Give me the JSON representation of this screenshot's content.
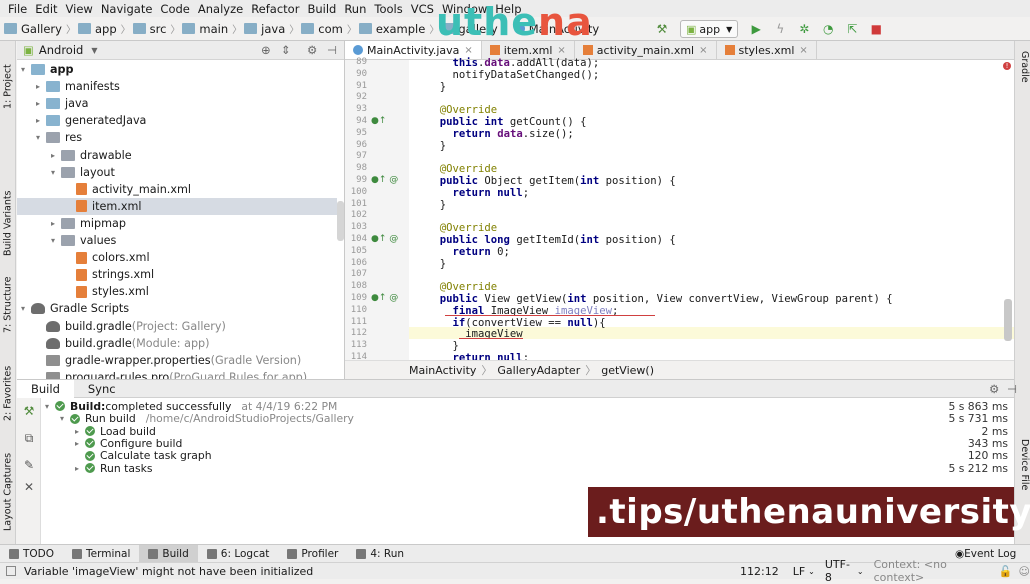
{
  "menu": [
    "File",
    "Edit",
    "View",
    "Navigate",
    "Code",
    "Analyze",
    "Refactor",
    "Build",
    "Run",
    "Tools",
    "VCS",
    "Window",
    "Help"
  ],
  "breadcrumb": [
    "Gallery",
    "app",
    "src",
    "main",
    "java",
    "com",
    "example",
    "gallery",
    "MainActivity"
  ],
  "logo": {
    "part1": "uthe",
    "part2": "na"
  },
  "run_config": "app",
  "project_view_label": "Android",
  "left_tool_tabs": [
    "1: Project",
    "Build Variants",
    "7: Structure",
    "2: Favorites",
    "Layout Captures"
  ],
  "right_tool_tabs": [
    "Gradle",
    "Device File"
  ],
  "tree": [
    {
      "label": "app",
      "extra": "",
      "icon": "folder",
      "indent": 0,
      "arrow": "▾"
    },
    {
      "label": "manifests",
      "extra": "",
      "icon": "folder",
      "indent": 1,
      "arrow": "▸"
    },
    {
      "label": "java",
      "extra": "",
      "icon": "folder",
      "indent": 1,
      "arrow": "▸"
    },
    {
      "label": "generatedJava",
      "extra": "",
      "icon": "folder",
      "indent": 1,
      "arrow": "▸"
    },
    {
      "label": "res",
      "extra": "",
      "icon": "folder-gray",
      "indent": 1,
      "arrow": "▾"
    },
    {
      "label": "drawable",
      "extra": "",
      "icon": "folder-gray",
      "indent": 2,
      "arrow": "▸"
    },
    {
      "label": "layout",
      "extra": "",
      "icon": "folder-gray",
      "indent": 2,
      "arrow": "▾"
    },
    {
      "label": "activity_main.xml",
      "extra": "",
      "icon": "xml",
      "indent": 3,
      "arrow": ""
    },
    {
      "label": "item.xml",
      "extra": "",
      "icon": "xml",
      "indent": 3,
      "arrow": "",
      "selected": true
    },
    {
      "label": "mipmap",
      "extra": "",
      "icon": "folder-gray",
      "indent": 2,
      "arrow": "▸"
    },
    {
      "label": "values",
      "extra": "",
      "icon": "folder-gray",
      "indent": 2,
      "arrow": "▾"
    },
    {
      "label": "colors.xml",
      "extra": "",
      "icon": "xml",
      "indent": 3,
      "arrow": ""
    },
    {
      "label": "strings.xml",
      "extra": "",
      "icon": "xml",
      "indent": 3,
      "arrow": ""
    },
    {
      "label": "styles.xml",
      "extra": "",
      "icon": "xml",
      "indent": 3,
      "arrow": ""
    },
    {
      "label": "Gradle Scripts",
      "extra": "",
      "icon": "gradle",
      "indent": 0,
      "arrow": "▾"
    },
    {
      "label": "build.gradle",
      "extra": " (Project: Gallery)",
      "icon": "gradle",
      "indent": 1,
      "arrow": ""
    },
    {
      "label": "build.gradle",
      "extra": " (Module: app)",
      "icon": "gradle",
      "indent": 1,
      "arrow": ""
    },
    {
      "label": "gradle-wrapper.properties",
      "extra": " (Gradle Version)",
      "icon": "prop",
      "indent": 1,
      "arrow": ""
    },
    {
      "label": "proguard-rules.pro",
      "extra": " (ProGuard Rules for app)",
      "icon": "prop",
      "indent": 1,
      "arrow": ""
    }
  ],
  "editor_tabs": [
    {
      "label": "MainActivity.java",
      "active": true
    },
    {
      "label": "item.xml",
      "active": false
    },
    {
      "label": "activity_main.xml",
      "active": false
    },
    {
      "label": "styles.xml",
      "active": false
    }
  ],
  "code_lines": [
    {
      "n": "89",
      "html": "    <span class=\"kw\">this</span>.<span class=\"fld\">data</span>.addAll(data);"
    },
    {
      "n": "90",
      "html": "    notifyDataSetChanged();"
    },
    {
      "n": "91",
      "html": "  }"
    },
    {
      "n": "92",
      "html": ""
    },
    {
      "n": "93",
      "html": "  <span class=\"an\">@Override</span>"
    },
    {
      "n": "94",
      "html": "  <span class=\"kw\">public int</span> getCount() {"
    },
    {
      "n": "95",
      "html": "    <span class=\"kw\">return</span> <span class=\"fld\">data</span>.size();"
    },
    {
      "n": "96",
      "html": "  }"
    },
    {
      "n": "97",
      "html": ""
    },
    {
      "n": "98",
      "html": "  <span class=\"an\">@Override</span>"
    },
    {
      "n": "99",
      "html": "  <span class=\"kw\">public</span> Object getItem(<span class=\"kw\">int</span> position) {"
    },
    {
      "n": "100",
      "html": "    <span class=\"kw\">return null</span>;"
    },
    {
      "n": "101",
      "html": "  }"
    },
    {
      "n": "102",
      "html": ""
    },
    {
      "n": "103",
      "html": "  <span class=\"an\">@Override</span>"
    },
    {
      "n": "104",
      "html": "  <span class=\"kw\">public long</span> getItemId(<span class=\"kw\">int</span> position) {"
    },
    {
      "n": "105",
      "html": "    <span class=\"kw\">return</span> 0;"
    },
    {
      "n": "106",
      "html": "  }"
    },
    {
      "n": "107",
      "html": ""
    },
    {
      "n": "108",
      "html": "  <span class=\"an\">@Override</span>"
    },
    {
      "n": "109",
      "html": "  <span class=\"kw\">public</span> View getView(<span class=\"kw\">int</span> position, View convertView, ViewGroup parent) {"
    },
    {
      "n": "110",
      "html": "    <span class=\"kw\">final</span> ImageView <span class=\"unused\">imageView</span>;"
    },
    {
      "n": "111",
      "html": "    <span class=\"kw\">if</span>(convertView == <span class=\"kw\">null</span>){"
    },
    {
      "n": "112",
      "html": "      imageView"
    },
    {
      "n": "113",
      "html": "    }"
    },
    {
      "n": "114",
      "html": "    <span class=\"kw\">return null</span>;"
    }
  ],
  "editor_breadcrumb": [
    "MainActivity",
    "GalleryAdapter",
    "getView()"
  ],
  "build_tabs": [
    "Build",
    "Sync"
  ],
  "build_rows": [
    {
      "indent": 0,
      "arrow": "▾",
      "bold": "Build:",
      "text": " completed successfully",
      "extra": "at 4/4/19 6:22 PM",
      "time": "5 s 863 ms"
    },
    {
      "indent": 1,
      "arrow": "▾",
      "bold": "",
      "text": "Run build",
      "extra": "/home/c/AndroidStudioProjects/Gallery",
      "time": "5 s 731 ms"
    },
    {
      "indent": 2,
      "arrow": "▸",
      "bold": "",
      "text": "Load build",
      "extra": "",
      "time": "2 ms"
    },
    {
      "indent": 2,
      "arrow": "▸",
      "bold": "",
      "text": "Configure build",
      "extra": "",
      "time": "343 ms"
    },
    {
      "indent": 2,
      "arrow": "",
      "bold": "",
      "text": "Calculate task graph",
      "extra": "",
      "time": "120 ms"
    },
    {
      "indent": 2,
      "arrow": "▸",
      "bold": "",
      "text": "Run tasks",
      "extra": "",
      "time": "5 s 212 ms"
    }
  ],
  "banner_text": ".tips/uthenauniversity",
  "bottom_tabs": [
    {
      "label": "TODO",
      "active": false
    },
    {
      "label": "Terminal",
      "active": false
    },
    {
      "label": "Build",
      "active": true
    },
    {
      "label": "6: Logcat",
      "active": false
    },
    {
      "label": "Profiler",
      "active": false
    },
    {
      "label": "4: Run",
      "active": false
    }
  ],
  "event_log": "Event Log",
  "status": {
    "message": "Variable 'imageView' might not have been initialized",
    "position": "112:12",
    "line_sep": "LF",
    "encoding": "UTF-8",
    "context": "Context: <no context>"
  }
}
